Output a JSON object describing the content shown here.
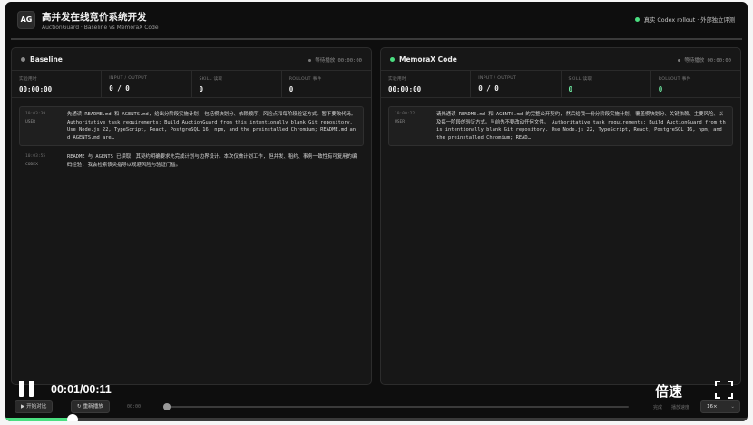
{
  "header": {
    "logo": "AG",
    "title": "高并发在线竞价系统开发",
    "subtitle": "AuctionGuard · Baseline vs MemoraX Code",
    "status": "真实 Codex rollout · 外部独立评测"
  },
  "panels": [
    {
      "title": "Baseline",
      "status": "等待播放 00:00:00",
      "metrics": [
        {
          "label": "实验用时",
          "value": "00:00:00"
        },
        {
          "label": "INPUT / OUTPUT",
          "value": "0 / 0"
        },
        {
          "label": "SKILL 读取",
          "value": "0"
        },
        {
          "label": "ROLLOUT 事件",
          "value": "0"
        }
      ],
      "messages": [
        {
          "time": "10:03:39",
          "role": "USER",
          "text": "先通读 README.md 和 AGENTS.md, 给出分阶段实施计划, 包括模块划分、依赖顺序、风险点和每阶段验证方式。暂不要改代码。 Authoritative task requirements: Build AuctionGuard from this intentionally blank Git repository. Use Node.js 22, TypeScript, React, PostgreSQL 16, npm, and the preinstalled Chromium; README.md and AGENTS.md are…"
        },
        {
          "time": "10:03:55",
          "role": "CODEX",
          "text": "README 与 AGENTS 已读取：其契约明确要求先完成计划与边界设计。本次仅做计划工作, 但并发、租约、事务一致性有可复用的编码经验, 我会检索该类指导以规避风险与验证门槛。"
        }
      ]
    },
    {
      "title": "MemoraX Code",
      "status": "等待播放 00:00:00",
      "metrics": [
        {
          "label": "实验用时",
          "value": "00:00:00"
        },
        {
          "label": "INPUT / OUTPUT",
          "value": "0 / 0"
        },
        {
          "label": "SKILL 读取",
          "value": "0"
        },
        {
          "label": "ROLLOUT 事件",
          "value": "0"
        }
      ],
      "messages": [
        {
          "time": "10:00:22",
          "role": "USER",
          "text": "请先通读 README.md 和 AGENTS.md 的完整公开契约, 然后给我一份分阶段实施计划, 覆盖模块划分、关键依赖、主要风险、以及每一阶段的验证方式。当前先不要改动任何文件。 Authoritative task requirements: Build AuctionGuard from this intentionally blank Git repository. Use Node.js 22, TypeScript, React, PostgreSQL 16, npm, and the preinstalled Chromium; READ…"
        }
      ]
    }
  ],
  "player": {
    "time": "00:01/00:11",
    "speed_label": "倍速",
    "start_compare": "▶ 开始对比",
    "replay": "↻ 重新播放",
    "scrub_time": "00:00",
    "label_complete": "完成",
    "label_speed": "播放速度",
    "speed_value": "16×",
    "progress_fraction": 0.09,
    "scrub_fraction": 0.0
  },
  "colors": {
    "accent": "#4ade80"
  }
}
